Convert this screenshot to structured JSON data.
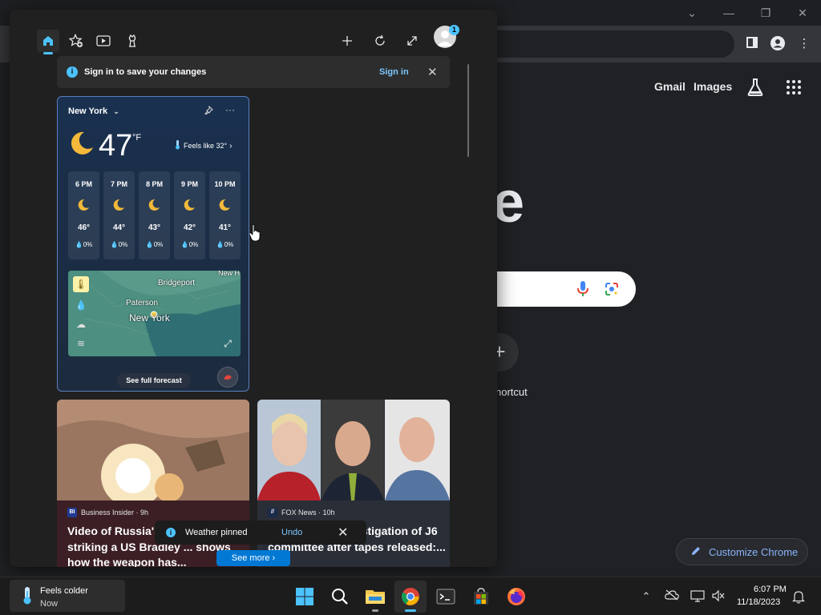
{
  "chrome": {
    "ntp_links": {
      "gmail": "Gmail",
      "images": "Images"
    },
    "logo_fragment": "e",
    "shortcut_add_label": "+",
    "shortcut_label": "hortcut",
    "customize_label": "Customize Chrome"
  },
  "widgets": {
    "signin_bar": {
      "info_glyph": "i",
      "message": "Sign in to save your changes",
      "link": "Sign in",
      "close_glyph": "✕"
    },
    "profile_badge_count": "1",
    "weather": {
      "location": "New York",
      "temperature": "47",
      "unit": "°F",
      "feels_like": "Feels like 32°",
      "hourly": [
        {
          "time": "6 PM",
          "temp": "46°",
          "precip": "0%"
        },
        {
          "time": "7 PM",
          "temp": "44°",
          "precip": "0%"
        },
        {
          "time": "8 PM",
          "temp": "43°",
          "precip": "0%"
        },
        {
          "time": "9 PM",
          "temp": "42°",
          "precip": "0%"
        },
        {
          "time": "10 PM",
          "temp": "41°",
          "precip": "0%"
        }
      ],
      "map_labels": {
        "bridgeport": "Bridgeport",
        "paterson": "Paterson",
        "newyork": "New York",
        "newhaven": "New H"
      },
      "forecast_button": "See full forecast"
    },
    "news": [
      {
        "source_logo": "BI",
        "source": "Business Insider · 9h",
        "headline": "Video of Russia's ... drone striking a US Bradley ... shows how the weapon has...",
        "logo_color": "#1f3a93"
      },
      {
        "source_logo": "//",
        "source": "FOX News · 10h",
        "headline": "... calls for ... investigation of J6 committee after tapes released:...",
        "logo_color": "#1b2b4a"
      }
    ],
    "toast": {
      "info_glyph": "i",
      "message": "Weather pinned",
      "action": "Undo",
      "close_glyph": "✕"
    },
    "see_more": "See more  ›"
  },
  "taskbar": {
    "weather": {
      "line1": "Feels colder",
      "line2": "Now"
    },
    "clock": {
      "time": "6:07 PM",
      "date": "11/18/2023"
    },
    "apps": [
      "start",
      "search",
      "file-explorer",
      "chrome",
      "terminal",
      "microsoft-store",
      "firefox"
    ]
  },
  "colors": {
    "accent": "#4cc2ff",
    "weather_card_border": "#5b7fbf",
    "link_blue": "#7cc7ff",
    "customize_blue": "#8ab4f8"
  }
}
